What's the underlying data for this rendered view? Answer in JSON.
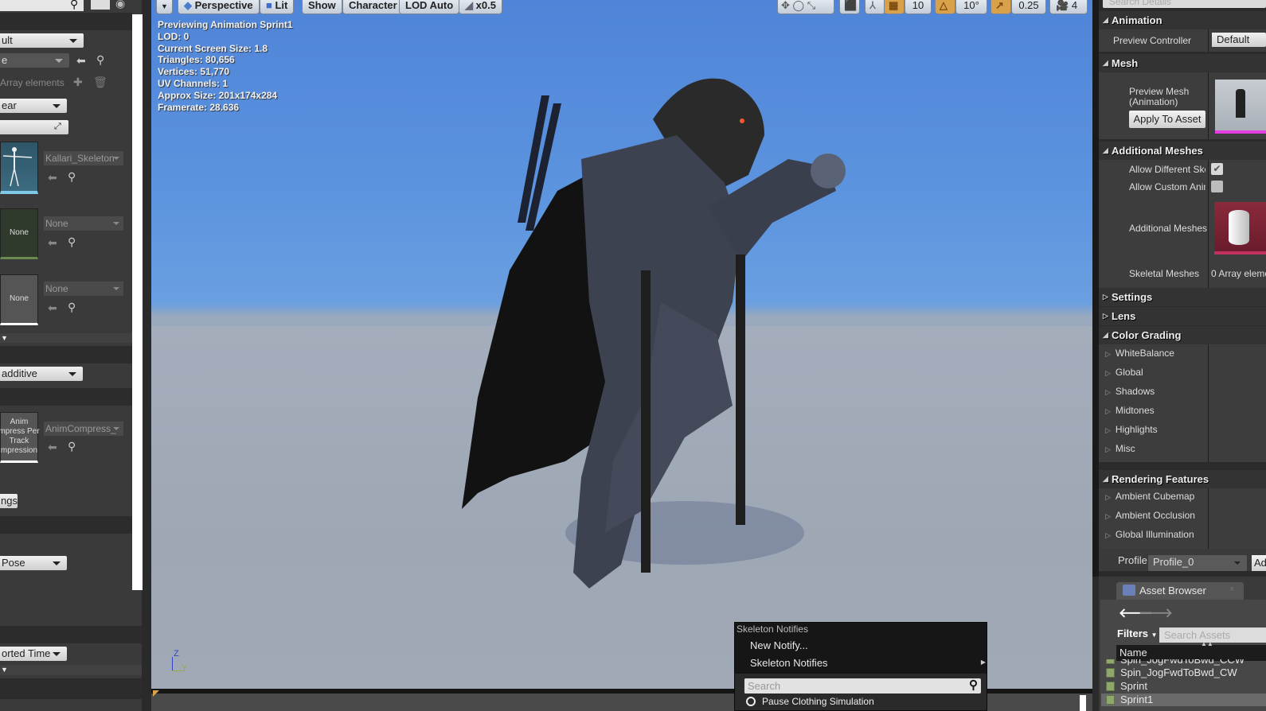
{
  "left_panel": {
    "dropdown_default": "ult",
    "dropdown_e": "e",
    "array_elements": "Array elements",
    "dropdown_ear": "ear",
    "skeleton_asset": "Kallari_Skeleton",
    "none_thumb_1": "None",
    "none_asset_1": "None",
    "none_thumb_2": "None",
    "none_asset_2": "None",
    "additive_dropdown": "additive",
    "compression_thumb": "Anim\nmpress Per\nTrack\nmpression",
    "compression_asset": "AnimCompress_",
    "settings_button": "ngs",
    "pose_dropdown": "Pose",
    "time_dropdown": "orted Time"
  },
  "viewport": {
    "toolbar": {
      "perspective": "Perspective",
      "lit": "Lit",
      "show": "Show",
      "character": "Character",
      "lod": "LOD Auto",
      "speed": "x0.5",
      "grid_snap": "10",
      "rot_snap": "10°",
      "scale_snap": "0.25",
      "camera_speed": "4"
    },
    "stats": [
      "Previewing Animation Sprint1",
      "LOD: 0",
      "Current Screen Size: 1.8",
      "Triangles: 80,656",
      "Vertices: 51,770",
      "UV Channels: 1",
      "Approx Size: 201x174x284",
      "Framerate: 28.636"
    ],
    "axis_z": "Z",
    "axis_y": "Y"
  },
  "details": {
    "search_placeholder": "Search Details",
    "animation": {
      "header": "Animation",
      "preview_controller_label": "Preview Controller",
      "preview_controller_value": "Default"
    },
    "mesh": {
      "header": "Mesh",
      "preview_mesh_label": "Preview Mesh (Animation)",
      "apply_button": "Apply To Asset"
    },
    "additional_meshes": {
      "header": "Additional Meshes",
      "allow_different_label": "Allow Different Ske",
      "allow_different_checked": true,
      "allow_custom_label": "Allow Custom Anin",
      "allow_custom_checked": false,
      "additional_meshes_label": "Additional Meshes",
      "skeletal_meshes_label": "Skeletal Meshes",
      "skeletal_meshes_value": "0 Array eleme"
    },
    "settings": "Settings",
    "lens": "Lens",
    "color_grading": {
      "header": "Color Grading",
      "items": [
        "WhiteBalance",
        "Global",
        "Shadows",
        "Midtones",
        "Highlights",
        "Misc"
      ]
    },
    "rendering_features": {
      "header": "Rendering Features",
      "items": [
        "Ambient Cubemap",
        "Ambient Occlusion",
        "Global Illumination"
      ]
    },
    "profile_label": "Profile",
    "profile_value": "Profile_0",
    "profile_add": "Ad"
  },
  "asset_browser": {
    "tab": "Asset Browser",
    "filters": "Filters",
    "search_placeholder": "Search Assets",
    "column_name": "Name",
    "items": [
      "Spin_JogFwdToBwd_CCW",
      "Spin_JogFwdToBwd_CW",
      "Sprint",
      "Sprint1"
    ],
    "selected": "Sprint1"
  },
  "context_menu": {
    "header": "Skeleton Notifies",
    "new_notify": "New Notify...",
    "skeleton_notifies": "Skeleton Notifies",
    "search_placeholder": "Search",
    "first_item": "Pause Clothing Simulation"
  }
}
